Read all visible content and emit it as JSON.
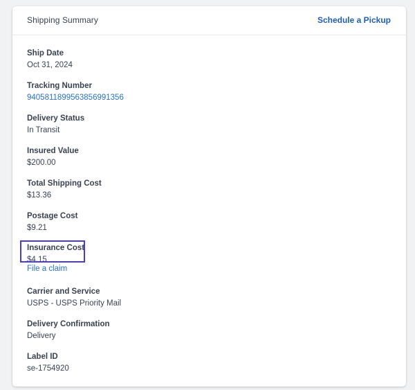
{
  "header": {
    "title": "Shipping Summary",
    "action_label": "Schedule a Pickup"
  },
  "fields": {
    "ship_date": {
      "label": "Ship Date",
      "value": "Oct 31, 2024"
    },
    "tracking_number": {
      "label": "Tracking Number",
      "value": "9405811899563856991356"
    },
    "delivery_status": {
      "label": "Delivery Status",
      "value": "In Transit"
    },
    "insured_value": {
      "label": "Insured Value",
      "value": "$200.00"
    },
    "total_shipping_cost": {
      "label": "Total Shipping Cost",
      "value": "$13.36"
    },
    "postage_cost": {
      "label": "Postage Cost",
      "value": "$9.21"
    },
    "insurance_cost": {
      "label": "Insurance Cost",
      "value": "$4.15",
      "link_label": "File a claim"
    },
    "carrier_service": {
      "label": "Carrier and Service",
      "value": "USPS - USPS Priority Mail"
    },
    "delivery_confirmation": {
      "label": "Delivery Confirmation",
      "value": "Delivery"
    },
    "label_id": {
      "label": "Label ID",
      "value": "se-1754920"
    }
  },
  "colors": {
    "link": "#2a72c5",
    "header_action": "#1f5fae",
    "highlight": "#4a3bd6",
    "text": "#3a4250"
  }
}
